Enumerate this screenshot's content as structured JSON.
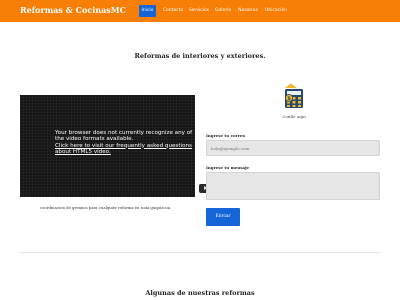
{
  "header": {
    "brand": "Reformas & CocinasMC",
    "nav": [
      {
        "label": "Inicio",
        "active": true
      },
      {
        "label": "Contacto",
        "active": false
      },
      {
        "label": "Servicios",
        "active": false
      },
      {
        "label": "Galería",
        "active": false
      },
      {
        "label": "Nosotros",
        "active": false
      },
      {
        "label": "Ubicación",
        "active": false
      }
    ]
  },
  "hero": {
    "title": "Reformas de interiores y exteriores."
  },
  "video": {
    "message": "Your browser does not currently recognize any of the video formats available.",
    "link_text": "Click here to visit our frequently asked questions about HTML5 video.",
    "caption": "coordinación de gremios para cualquier reforma en toda guipúzcoa."
  },
  "contact": {
    "logo_caption": "Confíe aquí",
    "email_label": "Ingrese tu correo",
    "email_placeholder": "hola@ejemplo.com",
    "message_label": "Ingrese tu mensaje",
    "message_placeholder": "",
    "send_label": "Enviar"
  },
  "gallery": {
    "title": "Algunas de nuestras reformas"
  },
  "colors": {
    "topbar": "#f77f07",
    "accent": "#1565d8"
  }
}
